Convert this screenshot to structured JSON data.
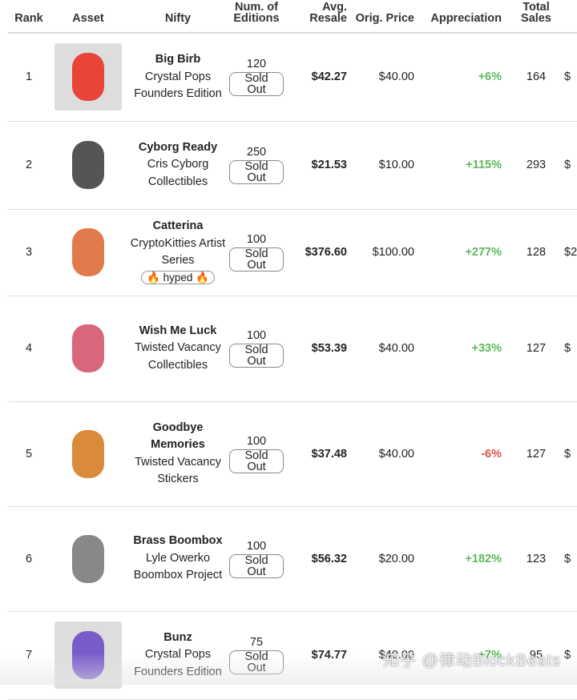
{
  "headers": {
    "rank": "Rank",
    "asset": "Asset",
    "nifty": "Nifty",
    "editions": "Num. of Editions",
    "avg_resale": "Avg. Resale",
    "orig_price": "Orig. Price",
    "appreciation": "Appreciation",
    "total_sales": "Total Sales"
  },
  "rows": [
    {
      "rank": "1",
      "title": "Big Birb",
      "sub": "Crystal Pops Founders Edition",
      "editions": "120",
      "status": "Sold Out",
      "avg": "$42.27",
      "orig": "$40.00",
      "appr": "+6%",
      "dir": "pos",
      "sales": "164",
      "cut": "$",
      "thumb": "#e8443a",
      "bg": "#ddd"
    },
    {
      "rank": "2",
      "title": "Cyborg Ready",
      "sub": "Cris Cyborg Collectibles",
      "editions": "250",
      "status": "Sold Out",
      "avg": "$21.53",
      "orig": "$10.00",
      "appr": "+115%",
      "dir": "pos",
      "sales": "293",
      "cut": "$",
      "thumb": "#555",
      "bg": "#fff"
    },
    {
      "rank": "3",
      "title": "Catterina",
      "sub": "CryptoKitties Artist Series",
      "badge": "🔥 hyped 🔥",
      "editions": "100",
      "status": "Sold Out",
      "avg": "$376.60",
      "orig": "$100.00",
      "appr": "+277%",
      "dir": "pos",
      "sales": "128",
      "cut": "$2",
      "thumb": "#e07a4a",
      "bg": "#fff"
    },
    {
      "rank": "4",
      "title": "Wish Me Luck",
      "sub": "Twisted Vacancy Collectibles",
      "editions": "100",
      "status": "Sold Out",
      "avg": "$53.39",
      "orig": "$40.00",
      "appr": "+33%",
      "dir": "pos",
      "sales": "127",
      "cut": "$",
      "thumb": "#d9667a",
      "bg": "#fff"
    },
    {
      "rank": "5",
      "title": "Goodbye Memories",
      "sub": "Twisted Vacancy Stickers",
      "editions": "100",
      "status": "Sold Out",
      "avg": "$37.48",
      "orig": "$40.00",
      "appr": "-6%",
      "dir": "neg",
      "sales": "127",
      "cut": "$",
      "thumb": "#d98a3a",
      "bg": "#fff"
    },
    {
      "rank": "6",
      "title": "Brass Boombox",
      "sub": "Lyle Owerko Boombox Project",
      "editions": "100",
      "status": "Sold Out",
      "avg": "$56.32",
      "orig": "$20.00",
      "appr": "+182%",
      "dir": "pos",
      "sales": "123",
      "cut": "$",
      "thumb": "#888",
      "bg": "#fff"
    },
    {
      "rank": "7",
      "title": "Bunz",
      "sub": "Crystal Pops Founders Edition",
      "editions": "75",
      "status": "Sold Out",
      "avg": "$74.77",
      "orig": "$40.00",
      "appr": "+7%",
      "dir": "pos",
      "sales": "95",
      "cut": "$",
      "thumb": "#7a5cc9",
      "bg": "#ddd"
    }
  ],
  "watermark": "知乎 @律动BlockBeats"
}
